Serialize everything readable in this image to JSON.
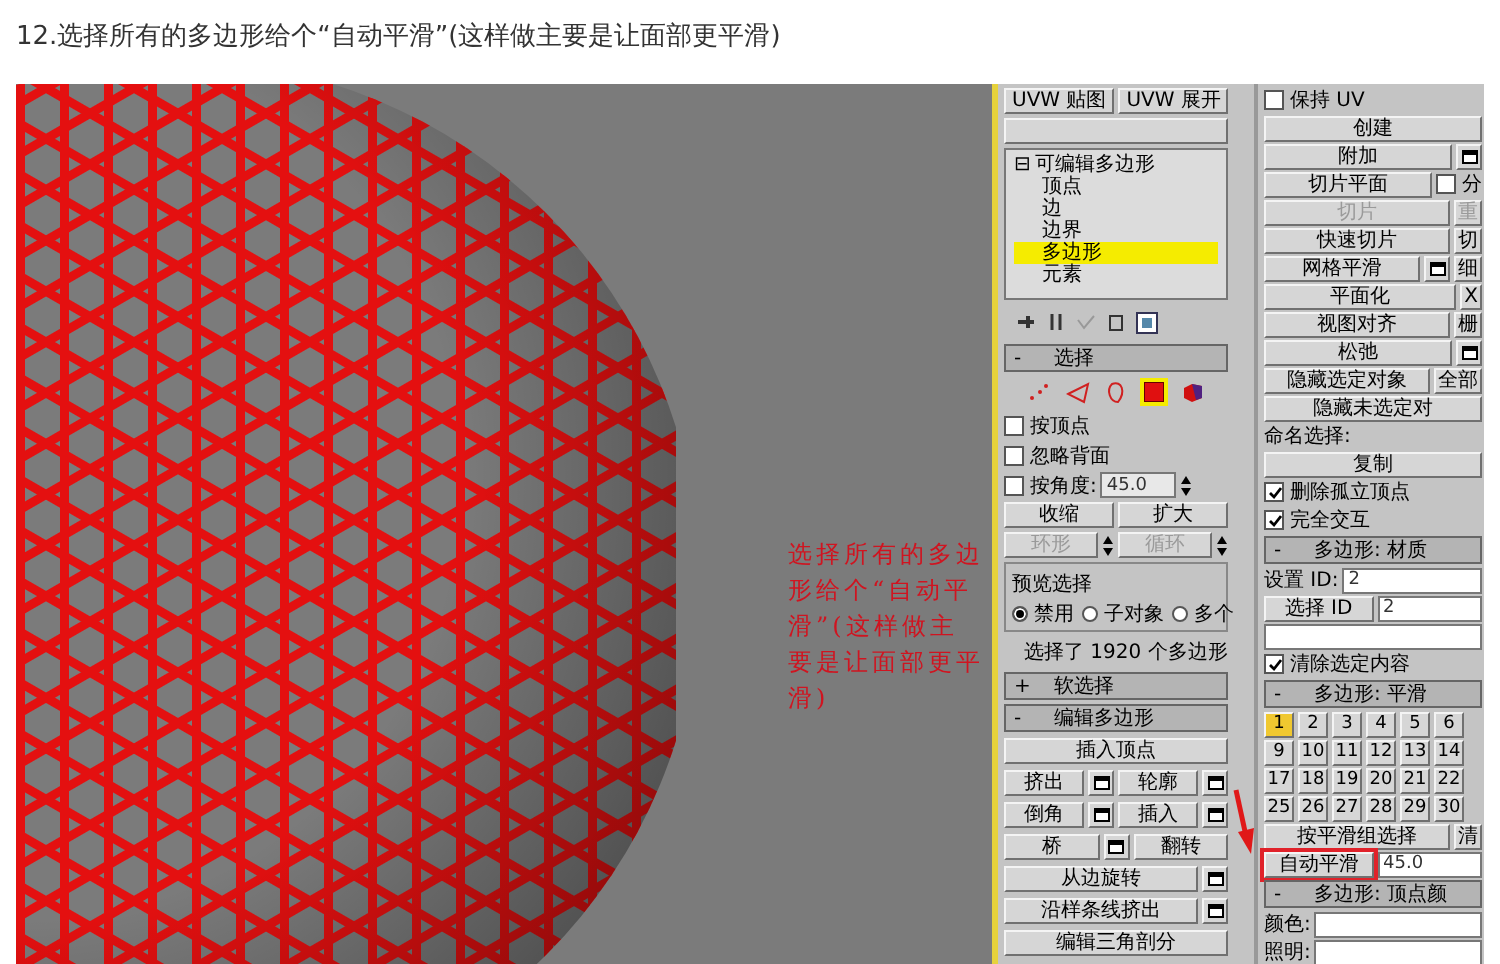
{
  "caption": "12.选择所有的多边形给个“自动平滑”(这样做主要是让面部更平滑)",
  "viewport": {
    "annotation": "选择所有的多边形给个“自动平滑”(这样做主要是让面部更平滑)"
  },
  "modifier_buttons": [
    "UVW 贴图",
    "UVW 展开"
  ],
  "modifier_stack": {
    "label": "可编辑多边形",
    "sign": "⊟",
    "children": [
      {
        "label": "顶点",
        "selected": false
      },
      {
        "label": "边",
        "selected": false
      },
      {
        "label": "边界",
        "selected": false
      },
      {
        "label": "多边形",
        "selected": true
      },
      {
        "label": "元素",
        "selected": false
      }
    ]
  },
  "selection": {
    "sign": "-",
    "title": "选择",
    "modes": [
      {
        "kind": "vertex",
        "selected": false
      },
      {
        "kind": "edge",
        "selected": false
      },
      {
        "kind": "border",
        "selected": false
      },
      {
        "kind": "polygon",
        "selected": true
      },
      {
        "kind": "element",
        "selected": false
      }
    ],
    "options": [
      {
        "label": "按顶点",
        "checked": false
      },
      {
        "label": "忽略背面",
        "checked": false
      },
      {
        "label": "按角度:",
        "checked": false,
        "value": "45.0"
      }
    ],
    "buttons": [
      {
        "label": "收缩",
        "disabled": false,
        "spinner": false
      },
      {
        "label": "扩大",
        "disabled": false,
        "spinner": false
      },
      {
        "label": "环形",
        "disabled": true,
        "spinner": true
      },
      {
        "label": "循环",
        "disabled": true,
        "spinner": true
      }
    ],
    "preview": {
      "title": "预览选择",
      "options": [
        {
          "label": "禁用",
          "selected": true
        },
        {
          "label": "子对象",
          "selected": false
        },
        {
          "label": "多个",
          "selected": false
        }
      ]
    },
    "status": "选择了 1920 个多边形"
  },
  "soft_selection": {
    "sign": "+",
    "title": "软选择"
  },
  "edit_polygons": {
    "sign": "-",
    "title": "编辑多边形",
    "rows": [
      [
        {
          "label": "插入顶点",
          "settings": false
        }
      ],
      [
        {
          "label": "挤出",
          "settings": true
        },
        {
          "label": "轮廓",
          "settings": true
        }
      ],
      [
        {
          "label": "倒角",
          "settings": true
        },
        {
          "label": "插入",
          "settings": true
        }
      ],
      [
        {
          "label": "桥",
          "settings": true
        },
        {
          "label": "翻转",
          "settings": false
        }
      ],
      [
        {
          "label": "从边旋转",
          "settings": true
        }
      ],
      [
        {
          "label": "沿样条线挤出",
          "settings": true
        }
      ],
      [
        {
          "label": "编辑三角剖分",
          "settings": false
        }
      ]
    ]
  },
  "right_rows": [
    {
      "cells": [
        {
          "kind": "check",
          "label": "保持 UV",
          "checked": false
        }
      ]
    },
    {
      "cells": [
        {
          "kind": "button",
          "label": "创建",
          "disabled": false
        }
      ]
    },
    {
      "cells": [
        {
          "kind": "button",
          "label": "附加",
          "disabled": false
        },
        {
          "kind": "settings"
        }
      ]
    },
    {
      "cells": [
        {
          "kind": "button",
          "label": "切片平面",
          "disabled": false
        },
        {
          "kind": "check",
          "label": "分",
          "checked": false
        }
      ]
    },
    {
      "cells": [
        {
          "kind": "button",
          "label": "切片",
          "disabled": true
        },
        {
          "kind": "button",
          "label": "重",
          "disabled": true
        }
      ]
    },
    {
      "cells": [
        {
          "kind": "button",
          "label": "快速切片",
          "disabled": false
        },
        {
          "kind": "button",
          "label": "切",
          "disabled": false
        }
      ]
    },
    {
      "cells": [
        {
          "kind": "button",
          "label": "网格平滑",
          "disabled": false
        },
        {
          "kind": "settings"
        },
        {
          "kind": "button",
          "label": "细",
          "disabled": false
        }
      ]
    },
    {
      "cells": [
        {
          "kind": "button",
          "label": "平面化",
          "disabled": false
        },
        {
          "kind": "button",
          "label": "X",
          "disabled": false
        }
      ]
    },
    {
      "cells": [
        {
          "kind": "button",
          "label": "视图对齐",
          "disabled": false
        },
        {
          "kind": "button",
          "label": "栅",
          "disabled": false
        }
      ]
    },
    {
      "cells": [
        {
          "kind": "button",
          "label": "松弛",
          "disabled": false
        },
        {
          "kind": "settings"
        }
      ]
    },
    {
      "cells": [
        {
          "kind": "button",
          "label": "隐藏选定对象",
          "disabled": false
        },
        {
          "kind": "button",
          "label": "全部",
          "disabled": false
        }
      ]
    },
    {
      "cells": [
        {
          "kind": "button",
          "label": "隐藏未选定对",
          "disabled": false
        }
      ]
    },
    {
      "cells": [
        {
          "kind": "label",
          "label": "命名选择:"
        }
      ]
    },
    {
      "cells": [
        {
          "kind": "button",
          "label": "复制",
          "disabled": false
        }
      ]
    },
    {
      "cells": [
        {
          "kind": "check",
          "label": "删除孤立顶点",
          "checked": true
        }
      ]
    },
    {
      "cells": [
        {
          "kind": "check",
          "label": "完全交互",
          "checked": true
        }
      ]
    },
    {
      "cells": [
        {
          "kind": "header",
          "sign": "-",
          "label": "多边形: 材质"
        }
      ]
    },
    {
      "cells": [
        {
          "kind": "label",
          "label": "设置 ID:"
        },
        {
          "kind": "field",
          "value": "2"
        }
      ]
    },
    {
      "cells": [
        {
          "kind": "button",
          "label": "选择 ID",
          "disabled": false
        },
        {
          "kind": "field",
          "value": "2"
        }
      ]
    },
    {
      "cells": [
        {
          "kind": "dropdown"
        }
      ]
    },
    {
      "cells": [
        {
          "kind": "check",
          "label": "清除选定内容",
          "checked": true
        }
      ]
    },
    {
      "cells": [
        {
          "kind": "header",
          "sign": "-",
          "label": "多边形: 平滑"
        }
      ]
    },
    {
      "cells": [
        {
          "kind": "group",
          "label": "1",
          "selected": true
        },
        {
          "kind": "group",
          "label": "2",
          "selected": false
        },
        {
          "kind": "group",
          "label": "3",
          "selected": false
        },
        {
          "kind": "group",
          "label": "4",
          "selected": false
        },
        {
          "kind": "group",
          "label": "5",
          "selected": false
        },
        {
          "kind": "group",
          "label": "6",
          "selected": false
        }
      ]
    },
    {
      "cells": [
        {
          "kind": "group",
          "label": "9",
          "selected": false
        },
        {
          "kind": "group",
          "label": "10",
          "selected": false
        },
        {
          "kind": "group",
          "label": "11",
          "selected": false
        },
        {
          "kind": "group",
          "label": "12",
          "selected": false
        },
        {
          "kind": "group",
          "label": "13",
          "selected": false
        },
        {
          "kind": "group",
          "label": "14",
          "selected": false
        }
      ]
    },
    {
      "cells": [
        {
          "kind": "group",
          "label": "17",
          "selected": false
        },
        {
          "kind": "group",
          "label": "18",
          "selected": false
        },
        {
          "kind": "group",
          "label": "19",
          "selected": false
        },
        {
          "kind": "group",
          "label": "20",
          "selected": false
        },
        {
          "kind": "group",
          "label": "21",
          "selected": false
        },
        {
          "kind": "group",
          "label": "22",
          "selected": false
        }
      ]
    },
    {
      "cells": [
        {
          "kind": "group",
          "label": "25",
          "selected": false
        },
        {
          "kind": "group",
          "label": "26",
          "selected": false
        },
        {
          "kind": "group",
          "label": "27",
          "selected": false
        },
        {
          "kind": "group",
          "label": "28",
          "selected": false
        },
        {
          "kind": "group",
          "label": "29",
          "selected": false
        },
        {
          "kind": "group",
          "label": "30",
          "selected": false
        }
      ]
    },
    {
      "cells": [
        {
          "kind": "button",
          "label": "按平滑组选择",
          "disabled": false
        },
        {
          "kind": "button",
          "label": "清",
          "disabled": false
        }
      ]
    },
    {
      "cells": [
        {
          "kind": "button",
          "label": "自动平滑",
          "disabled": false,
          "highlighted": true
        },
        {
          "kind": "field",
          "value": "45.0"
        }
      ]
    },
    {
      "cells": [
        {
          "kind": "header",
          "sign": "-",
          "label": "多边形: 顶点颜"
        }
      ]
    },
    {
      "cells": [
        {
          "kind": "label",
          "label": "颜色:"
        },
        {
          "kind": "field"
        }
      ]
    },
    {
      "cells": [
        {
          "kind": "label",
          "label": "照明:"
        },
        {
          "kind": "field"
        }
      ]
    }
  ]
}
